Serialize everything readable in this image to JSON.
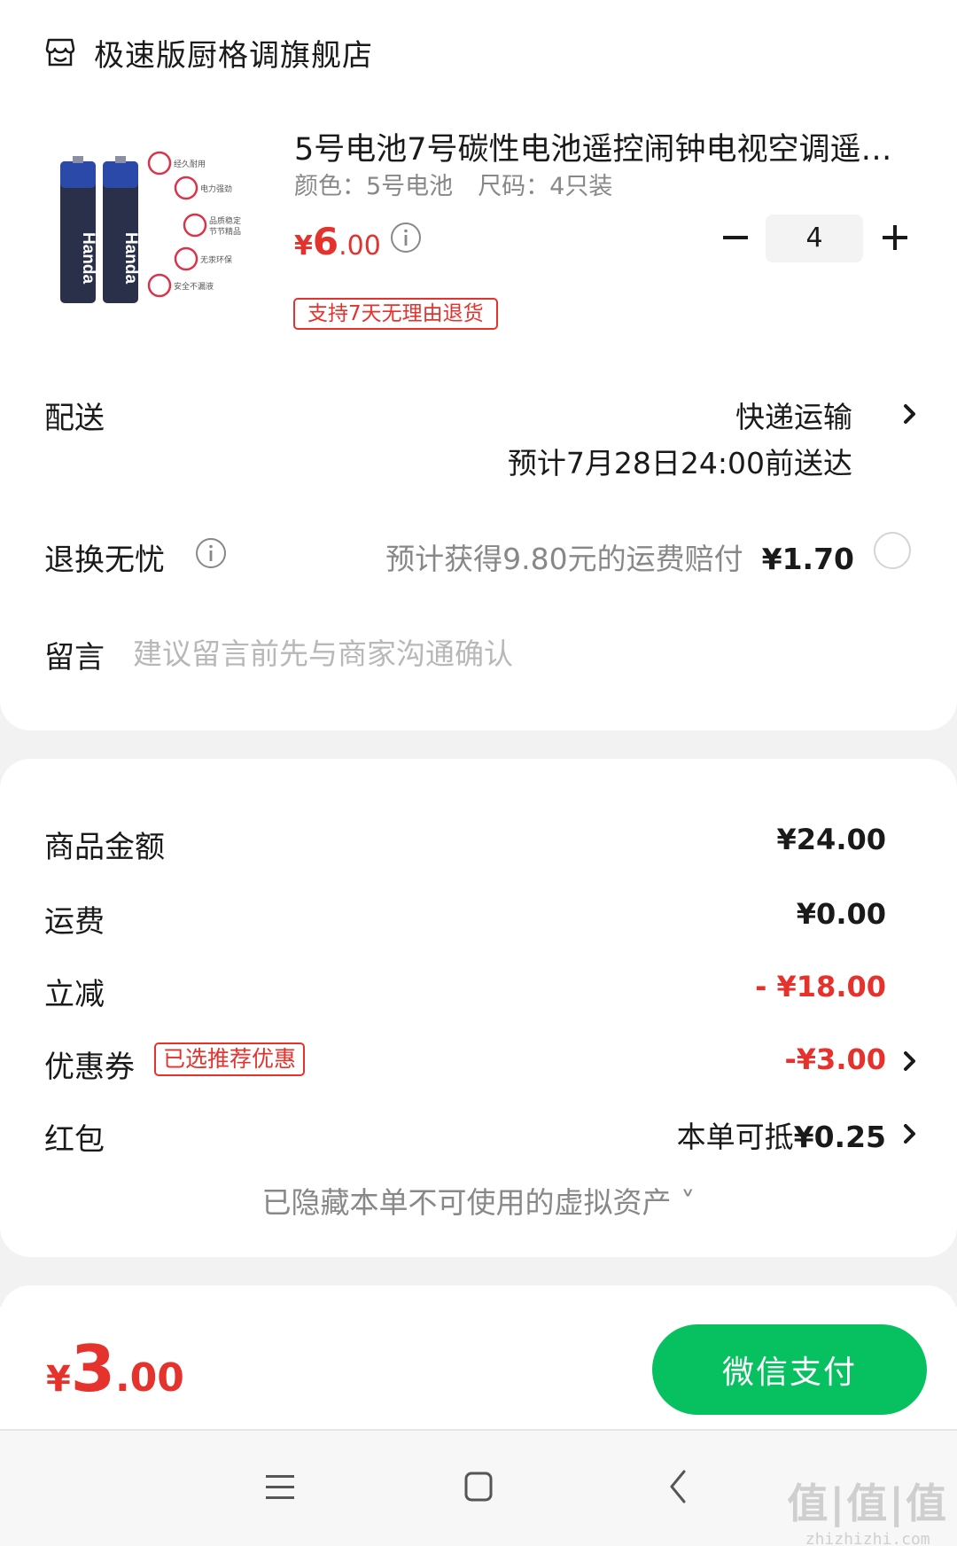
{
  "store": {
    "name": "极速版厨格调旗舰店",
    "icon": "store-icon"
  },
  "product": {
    "title": "5号电池7号碳性电池遥控闹钟电视空调遥…",
    "spec_color": "颜色：5号电池",
    "spec_size": "尺码：4只装",
    "price_symbol": "¥",
    "price_int": "6",
    "price_dec": ".00",
    "quantity": "4",
    "return_badge": "支持7天无理由退货",
    "image": {
      "brand": "Handa",
      "features": [
        "经久耐用",
        "电力强劲",
        "品质稳定\n节节精品",
        "无汞环保",
        "安全不漏液"
      ]
    }
  },
  "delivery": {
    "label": "配送",
    "method": "快递运输",
    "eta": "预计7月28日24:00前送达"
  },
  "insurance": {
    "label": "退换无忧",
    "desc": "预计获得9.80元的运费赔付",
    "price": "¥1.70"
  },
  "message": {
    "label": "留言",
    "placeholder": "建议留言前先与商家沟通确认"
  },
  "summary": {
    "goods_label": "商品金额",
    "goods_value": "¥24.00",
    "shipping_label": "运费",
    "shipping_value": "¥0.00",
    "discount_label": "立减",
    "discount_value": "- ¥18.00",
    "coupon_label": "优惠券",
    "coupon_tag": "已选推荐优惠",
    "coupon_value": "-¥3.00",
    "hongbao_label": "红包",
    "hongbao_prefix": "本单可抵",
    "hongbao_value": "¥0.25",
    "hidden_assets": "已隐藏本单不可使用的虚拟资产 ˅"
  },
  "checkout": {
    "total_symbol": "¥",
    "total_int": "3",
    "total_dec": ".00",
    "pay_button": "微信支付"
  },
  "watermark": {
    "big": "值|值|值",
    "small": "zhizhizhi.com"
  },
  "colors": {
    "accent_red": "#e5322d",
    "wechat_green": "#07c160",
    "muted": "#888888"
  }
}
